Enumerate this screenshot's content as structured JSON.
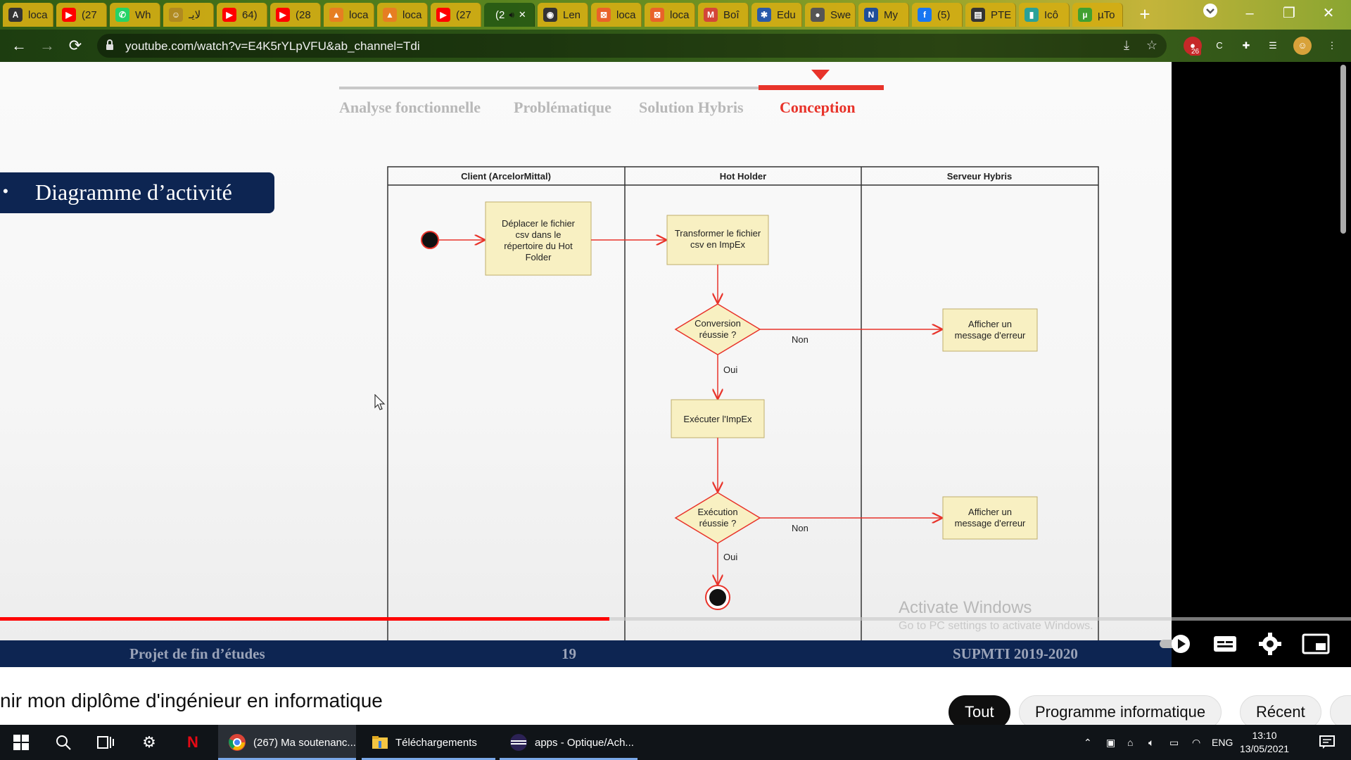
{
  "browser": {
    "tabs": [
      {
        "label": "loca",
        "icon": "A",
        "icon_name": "a-logo-icon",
        "color": "#333333"
      },
      {
        "label": "(27",
        "icon": "▶",
        "icon_name": "youtube-icon",
        "color": "#ff0000"
      },
      {
        "label": "Wh",
        "icon": "✆",
        "icon_name": "whatsapp-icon",
        "color": "#25d366"
      },
      {
        "label": "لايـ",
        "icon": "☺",
        "icon_name": "site-icon",
        "color": "#b08a20"
      },
      {
        "label": "64)",
        "icon": "▶",
        "icon_name": "youtube-icon",
        "color": "#ff0000"
      },
      {
        "label": "(28",
        "icon": "▶",
        "icon_name": "youtube-icon",
        "color": "#ff0000"
      },
      {
        "label": "loca",
        "icon": "▲",
        "icon_name": "xampp-icon",
        "color": "#e67e22"
      },
      {
        "label": "loca",
        "icon": "▲",
        "icon_name": "xampp-icon",
        "color": "#e67e22"
      },
      {
        "label": "(27",
        "icon": "▶",
        "icon_name": "youtube-icon",
        "color": "#ff0000"
      },
      {
        "label": "(2",
        "icon": "",
        "icon_name": "",
        "color": "#000000"
      },
      {
        "label": "Len",
        "icon": "◉",
        "icon_name": "location-pin-icon",
        "color": "#333333"
      },
      {
        "label": "loca",
        "icon": "⊠",
        "icon_name": "phpmyadmin-icon",
        "color": "#e9622a"
      },
      {
        "label": "loca",
        "icon": "⊠",
        "icon_name": "phpmyadmin-icon",
        "color": "#e9622a"
      },
      {
        "label": "Boî",
        "icon": "M",
        "icon_name": "gmail-icon",
        "color": "#d44638"
      },
      {
        "label": "Edu",
        "icon": "✱",
        "icon_name": "edu-icon",
        "color": "#2a5aa8"
      },
      {
        "label": "Swe",
        "icon": "●",
        "icon_name": "globe-icon",
        "color": "#555555"
      },
      {
        "label": "My",
        "icon": "N",
        "icon_name": "site-icon",
        "color": "#1f4e9a"
      },
      {
        "label": "(5)",
        "icon": "f",
        "icon_name": "facebook-icon",
        "color": "#1877f2"
      },
      {
        "label": "PTE",
        "icon": "▤",
        "icon_name": "monitor-icon",
        "color": "#333333"
      },
      {
        "label": "Icô",
        "icon": "▮",
        "icon_name": "site-icon",
        "color": "#2aa198"
      },
      {
        "label": "µTo",
        "icon": "µ",
        "icon_name": "utorrent-icon",
        "color": "#40a030"
      }
    ],
    "url": "youtube.com/watch?v=E4K5rYLpVFU&ab_channel=Tdi",
    "extension_badge": "26"
  },
  "slide": {
    "nav": [
      "Analyse fonctionnelle",
      "Problématique",
      "Solution Hybris",
      "Conception"
    ],
    "active_nav": "Conception",
    "section_title": "Diagramme d’activité",
    "footer_left": "Projet de fin d’études",
    "footer_page": "19",
    "footer_right": "SUPMTI 2019-2020"
  },
  "diagram": {
    "lanes": [
      "Client (ArcelorMittal)",
      "Hot Holder",
      "Serveur Hybris"
    ],
    "move_file": [
      "Déplacer le fichier",
      "csv dans le",
      "répertoire du Hot",
      "Folder"
    ],
    "transform": [
      "Transformer le fichier",
      "csv en ImpEx"
    ],
    "decision1": [
      "Conversion",
      "réussie ?"
    ],
    "execute": "Exécuter l'ImpEx",
    "decision2": [
      "Exécution",
      "réussie ?"
    ],
    "error": [
      "Afficher un",
      "message d'erreur"
    ],
    "no": "Non",
    "yes": "Oui"
  },
  "watermark": {
    "title": "Activate Windows",
    "subtitle": "Go to PC settings to activate Windows."
  },
  "player": {
    "progress": 0.451
  },
  "below": {
    "video_title": "nir mon diplôme d'ingénieur en informatique",
    "chips": [
      "Tout",
      "Programme informatique",
      "Récent"
    ]
  },
  "taskbar": {
    "apps": [
      "(267) Ma soutenanc...",
      "Téléchargements",
      "apps - Optique/Ach..."
    ],
    "lang": "ENG",
    "time": "13:10",
    "date": "13/05/2021"
  }
}
